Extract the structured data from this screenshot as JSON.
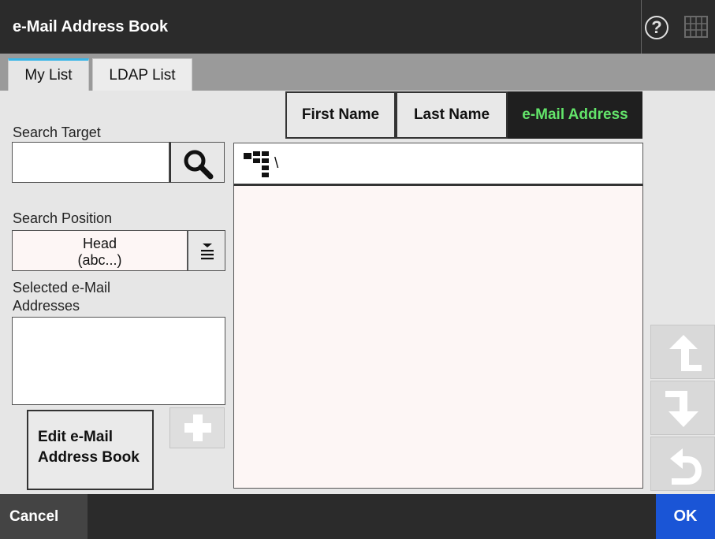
{
  "window": {
    "title": "e-Mail Address Book"
  },
  "header": {
    "help_label": "?",
    "icons": [
      "help-icon",
      "keyboard-icon"
    ]
  },
  "tabs": [
    {
      "label": "My List",
      "active": true
    },
    {
      "label": "LDAP List",
      "active": false
    }
  ],
  "search": {
    "target_label": "Search Target",
    "target_value": "",
    "position_label": "Search Position",
    "position_value_line1": "Head",
    "position_value_line2": "(abc...)"
  },
  "selected": {
    "label": "Selected e-Mail Addresses",
    "items": []
  },
  "buttons": {
    "edit_book": "Edit e-Mail Address Book",
    "cancel": "Cancel",
    "ok": "OK"
  },
  "sort": {
    "first_name": "First Name",
    "last_name": "Last Name",
    "email": "e-Mail Address",
    "active": "email"
  },
  "list": {
    "path": "\\",
    "entries": []
  },
  "colors": {
    "active_sort_text": "#63e46a",
    "ok_button": "#1a55d6",
    "active_tab_accent": "#39b6e8",
    "title_bar": "#2b2b2b"
  }
}
